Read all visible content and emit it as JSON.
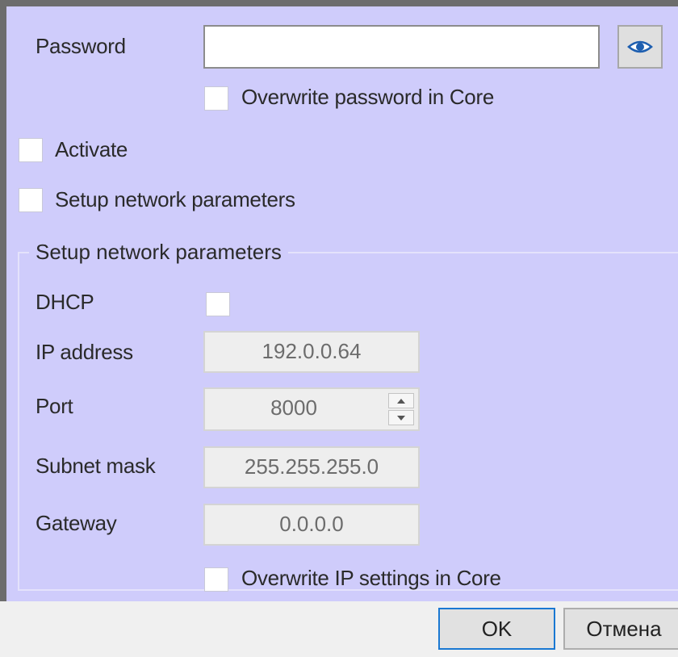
{
  "password": {
    "label": "Password",
    "value": "",
    "show_icon": "eye-icon"
  },
  "checkboxes": {
    "overwrite_password": {
      "label": "Overwrite password in Core",
      "checked": false
    },
    "activate": {
      "label": "Activate",
      "checked": false
    },
    "setup_network": {
      "label": "Setup network parameters",
      "checked": false
    },
    "dhcp": {
      "label": "DHCP",
      "checked": false
    },
    "overwrite_ip": {
      "label": "Overwrite IP settings in Core",
      "checked": false
    }
  },
  "network_group": {
    "title": "Setup network parameters",
    "ip_address": {
      "label": "IP address",
      "value": "192.0.0.64"
    },
    "port": {
      "label": "Port",
      "value": "8000"
    },
    "subnet_mask": {
      "label": "Subnet mask",
      "value": "255.255.255.0"
    },
    "gateway": {
      "label": "Gateway",
      "value": "0.0.0.0"
    }
  },
  "buttons": {
    "ok": "OK",
    "cancel": "Отмена"
  },
  "colors": {
    "panel_background": "#cfccfb",
    "ok_focus_border": "#1a78d2",
    "eye_icon": "#1e5fb0"
  }
}
